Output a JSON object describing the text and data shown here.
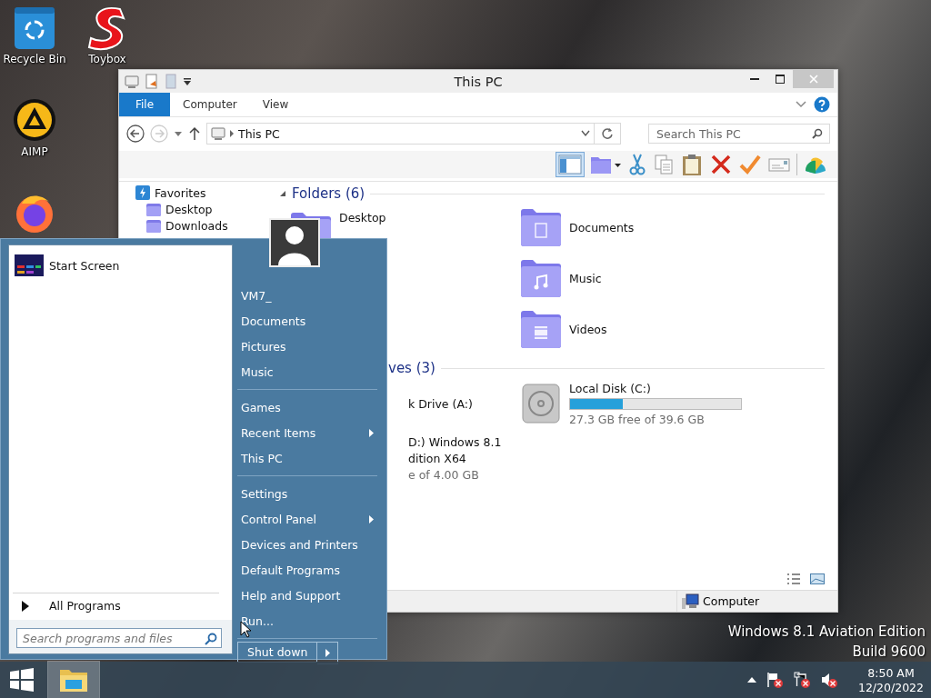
{
  "desktop": {
    "icons": [
      {
        "label": "Recycle Bin",
        "kind": "recycle"
      },
      {
        "label": "Toybox",
        "kind": "toybox"
      },
      {
        "label": "AIMP",
        "kind": "aimp"
      },
      {
        "kind": "firefox"
      }
    ],
    "edition_lines": [
      "Windows 8.1 Aviation Edition",
      "Build 9600"
    ]
  },
  "explorer": {
    "title": "This PC",
    "ribbon_tabs": [
      {
        "label": "File",
        "selected": true
      },
      {
        "label": "Computer",
        "selected": false
      },
      {
        "label": "View",
        "selected": false
      }
    ],
    "address": "This PC",
    "search": {
      "placeholder": "Search This PC"
    },
    "navigation": [
      {
        "label": "Favorites",
        "kind": "group"
      },
      {
        "label": "Desktop",
        "kind": "folder"
      },
      {
        "label": "Downloads",
        "kind": "folder"
      }
    ],
    "folders_header": "Folders (6)",
    "folders": [
      {
        "label": "Desktop",
        "kind": "desktop"
      },
      {
        "label": "Documents",
        "kind": "documents"
      },
      {
        "kind": "downloads"
      },
      {
        "label": "Music",
        "kind": "music"
      },
      {
        "kind": "pictures"
      },
      {
        "label": "Videos",
        "kind": "videos"
      }
    ],
    "drives_header": "ves (3)",
    "drives": [
      {
        "label_lines": [
          "k Drive (A:)"
        ],
        "kind": "floppy"
      },
      {
        "label_lines": [
          "Local Disk (C:)"
        ],
        "kind": "disk",
        "level": 0.31,
        "free": "27.3 GB free of 39.6 GB"
      },
      {
        "label_lines": [
          "D:) Windows 8.1",
          "dition X64"
        ],
        "kind": "cd",
        "free": "e of 4.00 GB"
      }
    ],
    "status": "Computer"
  },
  "start_menu": {
    "pinned": [
      {
        "label": "Start Screen"
      }
    ],
    "all_programs": "All Programs",
    "search": {
      "placeholder": "Search programs and files"
    },
    "place_groups": [
      {
        "items": [
          {
            "label": "VM7_",
            "submenu": false
          },
          {
            "label": "Documents",
            "submenu": false
          },
          {
            "label": "Pictures",
            "submenu": false
          },
          {
            "label": "Music",
            "submenu": false
          }
        ]
      },
      {
        "items": [
          {
            "label": "Games",
            "submenu": false
          },
          {
            "label": "Recent Items",
            "submenu": true
          },
          {
            "label": "This PC",
            "submenu": false
          }
        ]
      },
      {
        "items": [
          {
            "label": "Settings",
            "submenu": false
          },
          {
            "label": "Control Panel",
            "submenu": true
          },
          {
            "label": "Devices and Printers",
            "submenu": false
          },
          {
            "label": "Default Programs",
            "submenu": false
          },
          {
            "label": "Help and Support",
            "submenu": false
          },
          {
            "label": "Run...",
            "submenu": false
          }
        ]
      }
    ],
    "shutdown": "Shut down"
  },
  "taskbar": {
    "apps": [
      {
        "kind": "explorer",
        "active": true
      }
    ],
    "clock": {
      "time": "8:50 AM",
      "date": "12/20/2022"
    }
  }
}
